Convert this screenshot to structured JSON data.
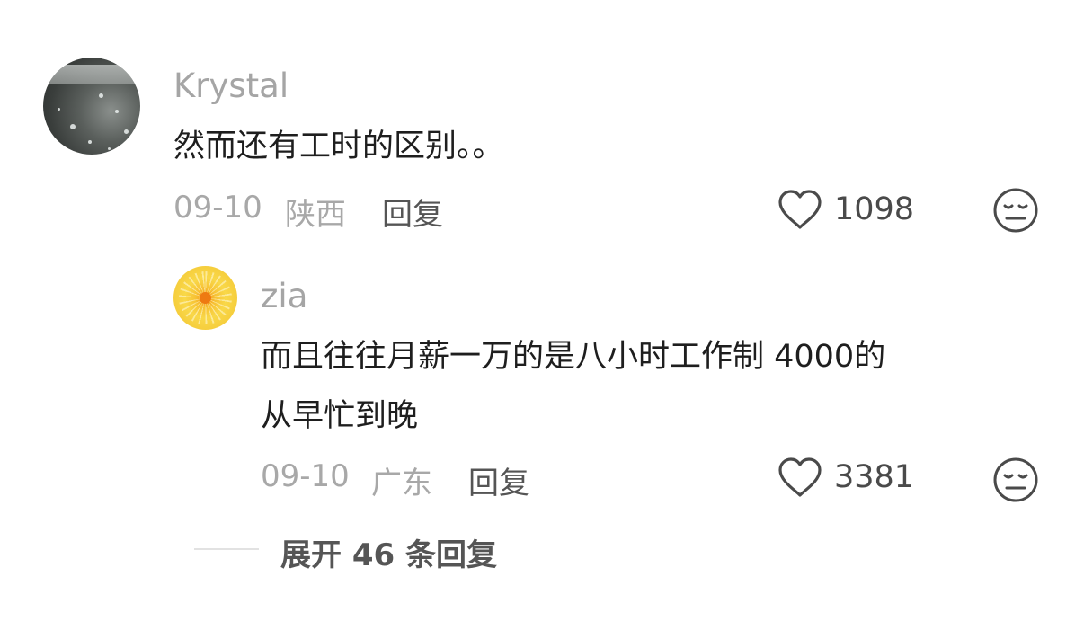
{
  "comment": {
    "username": "Krystal",
    "text": "然而还有工时的区别。。",
    "date": "09-10",
    "location": "陕西",
    "reply_label": "回复",
    "likes": "1098",
    "like_icon": "heart-outline-icon",
    "dislike_icon": "unamused-face-icon"
  },
  "reply": {
    "username": "zia",
    "text_line1": "而且往往月薪一万的是八小时工作制 4000的",
    "text_line2": "从早忙到晚",
    "date": "09-10",
    "location": "广东",
    "reply_label": "回复",
    "likes": "3381",
    "like_icon": "heart-outline-icon",
    "dislike_icon": "unamused-face-icon"
  },
  "expand": {
    "label": "展开 46 条回复"
  }
}
